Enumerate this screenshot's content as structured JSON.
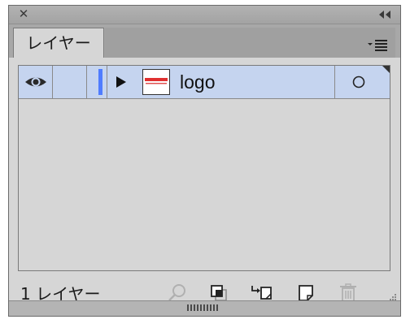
{
  "panel": {
    "close_symbol": "✕",
    "collapse_icon": "double-chevron-left-icon",
    "menu_icon": "panel-menu-icon"
  },
  "tabs": [
    {
      "label": "レイヤー",
      "active": true
    }
  ],
  "layers": [
    {
      "name": "logo",
      "visible": true,
      "locked": false,
      "color": "#4f7cff",
      "selected": true,
      "thumbnail_icon": "logo-thumbnail-icon"
    }
  ],
  "footer": {
    "layer_count_text": "1 レイヤー",
    "buttons": [
      {
        "icon": "search-icon",
        "enabled": false
      },
      {
        "icon": "clipping-mask-icon",
        "enabled": true
      },
      {
        "icon": "create-sublayer-icon",
        "enabled": true
      },
      {
        "icon": "new-layer-icon",
        "enabled": true
      },
      {
        "icon": "trash-icon",
        "enabled": false
      }
    ]
  },
  "colors": {
    "panel_bg": "#d6d6d6",
    "row_selected": "#c5d4ef",
    "layer_color": "#4f7cff"
  }
}
